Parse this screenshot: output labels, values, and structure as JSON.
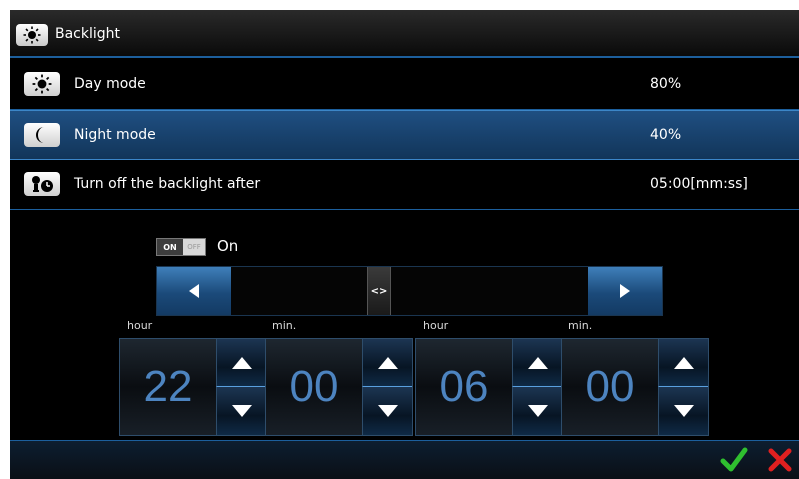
{
  "window": {
    "title": "Backlight",
    "title_icon": "sun-icon"
  },
  "menu": [
    {
      "label": "Day mode",
      "value": "80%",
      "icon": "sun-icon",
      "selected": false
    },
    {
      "label": "Night mode",
      "value": "40%",
      "icon": "moon-icon",
      "selected": true
    },
    {
      "label": "Turn off the backlight after",
      "value": "05:00[mm:ss]",
      "icon": "bulb-clock-icon",
      "selected": false
    }
  ],
  "toggle": {
    "on_label": "ON",
    "off_label": "OFF",
    "state_text": "On"
  },
  "range": {
    "handle_label": "<>"
  },
  "columns": [
    "hour",
    "min.",
    "hour",
    "min."
  ],
  "spinners": [
    {
      "value": "22"
    },
    {
      "value": "00"
    },
    {
      "value": "06"
    },
    {
      "value": "00"
    }
  ],
  "footer": {
    "ok": "confirm-check-icon",
    "cancel": "cancel-x-icon"
  },
  "colors": {
    "accent": "#1d5f9c",
    "selected_row": "#1b4a7a",
    "digit": "#4d84c0",
    "ok": "#2fbf2f",
    "cancel": "#e02020"
  }
}
